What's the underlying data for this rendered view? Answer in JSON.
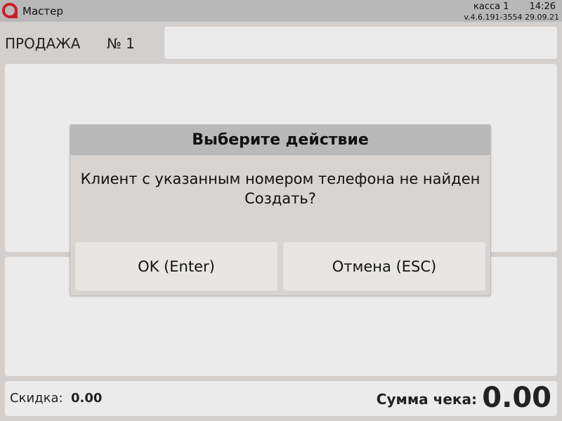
{
  "window": {
    "title": "Мастер",
    "register": "касса 1",
    "time": "14:26",
    "version": "v.4.6.191-3554  29.09.21",
    "brand_color": "#cc1f2a",
    "logo_icon": "logo-icon"
  },
  "sale": {
    "label": "ПРОДАЖА",
    "number": "№ 1",
    "search_value": ""
  },
  "footer": {
    "discount_label": "Скидка:",
    "discount_value": "0.00",
    "total_label": "Сумма чека:",
    "total_value": "0.00"
  },
  "dialog": {
    "title": "Выберите действие",
    "message_line1": "Клиент с указанным номером телефона не найден",
    "message_line2": "Создать?",
    "ok_label": "OK (Enter)",
    "cancel_label": "Отмена (ESC)"
  }
}
